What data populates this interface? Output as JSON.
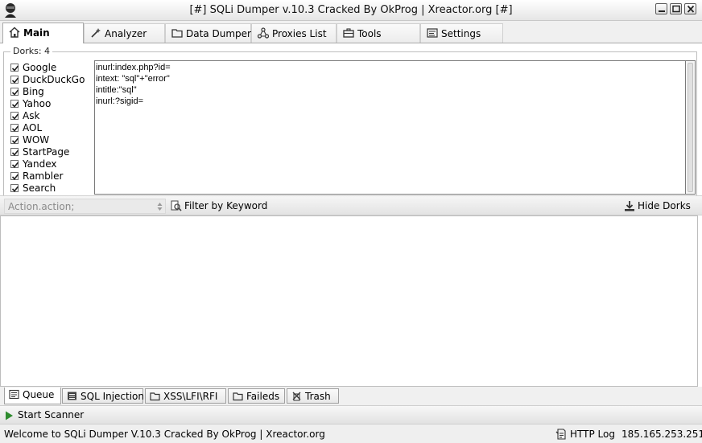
{
  "window": {
    "title": "[#] SQLi Dumper v.10.3 Cracked By OkProg | Xreactor.org [#]"
  },
  "tabs": [
    {
      "label": "Main",
      "icon": "home-icon"
    },
    {
      "label": "Analyzer",
      "icon": "wand-icon"
    },
    {
      "label": "Data Dumper",
      "icon": "folder-icon"
    },
    {
      "label": "Proxies List",
      "icon": "network-icon"
    },
    {
      "label": "Tools",
      "icon": "toolbox-icon"
    },
    {
      "label": "Settings",
      "icon": "settings-icon"
    }
  ],
  "dorks": {
    "legend": "Dorks:  4",
    "engines": [
      {
        "label": "Google",
        "checked": true
      },
      {
        "label": "DuckDuckGo",
        "checked": true
      },
      {
        "label": "Bing",
        "checked": true
      },
      {
        "label": "Yahoo",
        "checked": true
      },
      {
        "label": "Ask",
        "checked": true
      },
      {
        "label": "AOL",
        "checked": true
      },
      {
        "label": "WOW",
        "checked": true
      },
      {
        "label": "StartPage",
        "checked": true
      },
      {
        "label": "Yandex",
        "checked": true
      },
      {
        "label": "Rambler",
        "checked": true
      },
      {
        "label": "Search",
        "checked": true
      }
    ],
    "lines": [
      "inurl:index.php?id=",
      "intext: \"sql\"+\"error\"",
      "intitle:\"sql\"",
      "inurl:?sigid="
    ]
  },
  "toolbar": {
    "action_value": "Action.action;",
    "filter_label": "Filter by Keyword",
    "hide_dorks_label": "Hide Dorks"
  },
  "bottom_tabs": [
    {
      "label": "Queue",
      "icon": "queue-icon"
    },
    {
      "label": "SQL Injection",
      "icon": "database-icon"
    },
    {
      "label": "XSS\\LFI\\RFI",
      "icon": "folder-icon"
    },
    {
      "label": "Faileds",
      "icon": "folder-icon"
    },
    {
      "label": "Trash",
      "icon": "trash-icon"
    }
  ],
  "scanner": {
    "start_label": "Start Scanner"
  },
  "status": {
    "message": "Welcome to  SQLi Dumper V.10.3 Cracked By OkProg | Xreactor.org",
    "http_log_label": "HTTP Log",
    "ip": "185.165.253.251"
  },
  "colors": {
    "play": "#2e8b2e",
    "accent_border": "#a9a9a9"
  }
}
